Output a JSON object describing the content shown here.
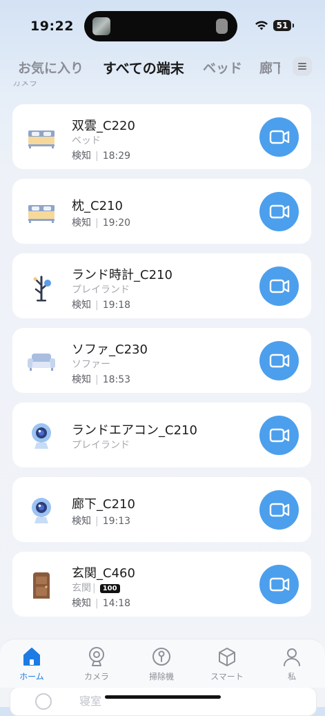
{
  "status_bar": {
    "time": "19:22",
    "battery": "51"
  },
  "tabs": [
    {
      "label": "お気に入り",
      "active": false
    },
    {
      "label": "すべての端末",
      "active": true
    },
    {
      "label": "ベッド",
      "active": false
    },
    {
      "label": "廊下",
      "active": false
    }
  ],
  "section_peek": "カメラ",
  "devices": [
    {
      "name": "双雲_C220",
      "room": "ベッド",
      "event": "検知",
      "time": "18:29",
      "icon": "bed-icon"
    },
    {
      "name": "枕_C210",
      "room": "",
      "event": "検知",
      "time": "19:20",
      "icon": "bed-icon"
    },
    {
      "name": "ランド時計_C210",
      "room": "プレイランド",
      "event": "検知",
      "time": "19:18",
      "icon": "tree-icon"
    },
    {
      "name": "ソファ_C230",
      "room": "ソファー",
      "event": "検知",
      "time": "18:53",
      "icon": "sofa-icon"
    },
    {
      "name": "ランドエアコン_C210",
      "room": "プレイランド",
      "event": "",
      "time": "",
      "icon": "camera-device-icon"
    },
    {
      "name": "廊下_C210",
      "room": "",
      "event": "検知",
      "time": "19:13",
      "icon": "camera-device-icon"
    },
    {
      "name": "玄関_C460",
      "room": "玄関",
      "badge": "100",
      "event": "検知",
      "time": "14:18",
      "icon": "door-icon"
    }
  ],
  "bottom_peek": "寝室",
  "nav": [
    {
      "label": "ホーム",
      "icon": "home-icon",
      "active": true
    },
    {
      "label": "カメラ",
      "icon": "camera-icon",
      "active": false
    },
    {
      "label": "掃除機",
      "icon": "robot-vacuum-icon",
      "active": false
    },
    {
      "label": "スマート",
      "icon": "cube-icon",
      "active": false
    },
    {
      "label": "私",
      "icon": "person-icon",
      "active": false
    }
  ],
  "colors": {
    "accent": "#4c9fec",
    "active_nav": "#1e7be3"
  }
}
